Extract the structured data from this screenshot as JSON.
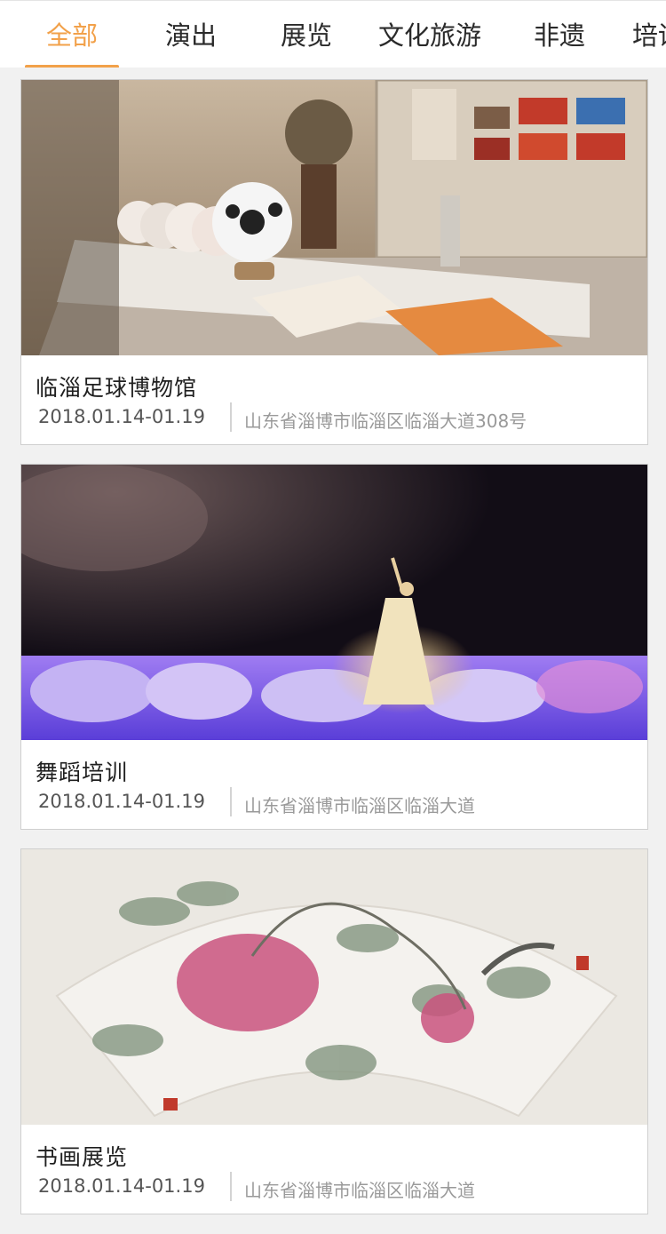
{
  "tabs": [
    {
      "label": "全部",
      "active": true
    },
    {
      "label": "演出",
      "active": false
    },
    {
      "label": "展览",
      "active": false
    },
    {
      "label": "文化旅游",
      "active": false
    },
    {
      "label": "非遗",
      "active": false
    },
    {
      "label": "培训",
      "active": false
    }
  ],
  "colors": {
    "accent": "#f2a14a",
    "text": "#2a2a2a",
    "muted": "#9a9a9a",
    "background": "#f1f1f1"
  },
  "cards": [
    {
      "title": "临淄足球博物馆",
      "date": "2018.01.14-01.19",
      "address": "山东省淄博市临淄区临淄大道308号",
      "image": "football-museum-exhibit-photo"
    },
    {
      "title": "舞蹈培训",
      "date": "2018.01.14-01.19",
      "address": "山东省淄博市临淄区临淄大道",
      "image": "dance-performance-stage-photo"
    },
    {
      "title": "书画展览",
      "date": "2018.01.14-01.19",
      "address": "山东省淄博市临淄区临淄大道",
      "image": "peony-fan-painting"
    }
  ]
}
